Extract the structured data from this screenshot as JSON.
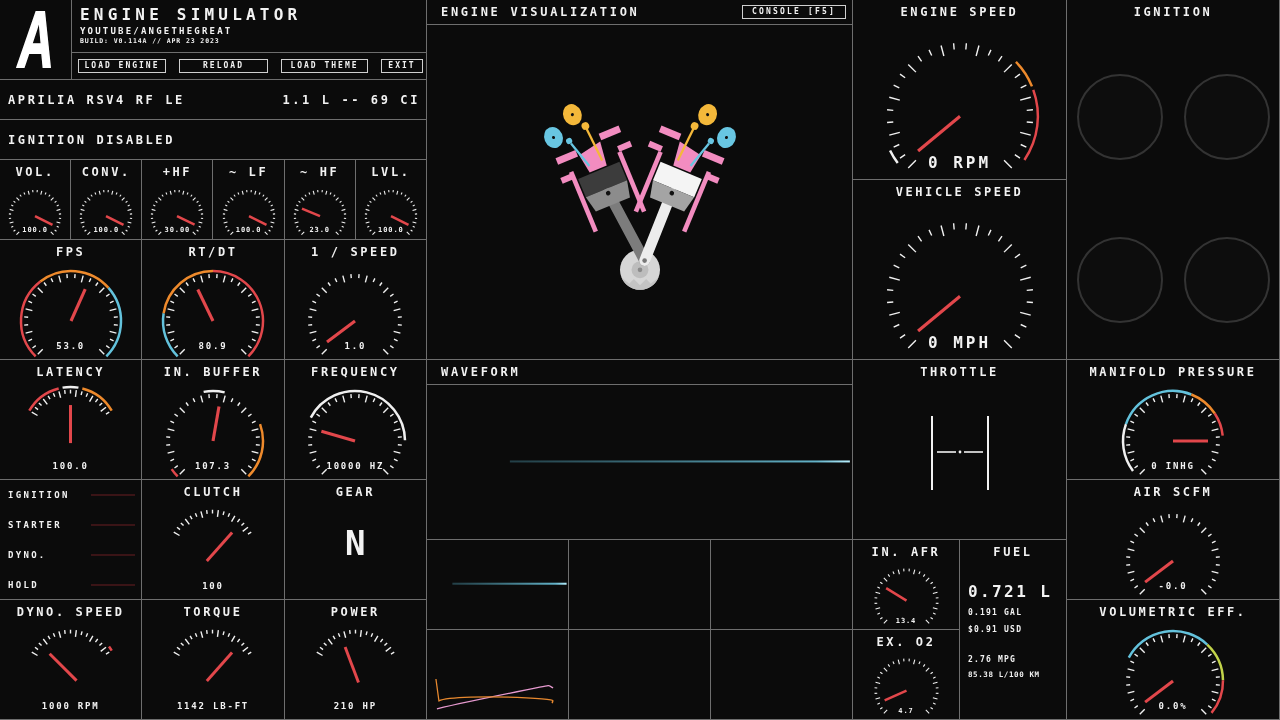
{
  "header": {
    "logo": "A",
    "title": "ENGINE SIMULATOR",
    "channel": "YOUTUBE/ANGETHEGREAT",
    "build": "BUILD: V0.114A // APR 23 2023",
    "buttons": [
      "LOAD ENGINE",
      "RELOAD",
      "LOAD THEME",
      "EXIT"
    ]
  },
  "engine": {
    "name": "APRILIA RSV4 RF LE",
    "displacement": "1.1 L -- 69 CI"
  },
  "status": "IGNITION DISABLED",
  "audio_gauges": [
    {
      "title": "VOL.",
      "kind": "wide",
      "reading": "100.0"
    },
    {
      "title": "CONV.",
      "kind": "wide",
      "reading": "100.0"
    },
    {
      "title": "+HF",
      "kind": "wide",
      "reading": "30.00"
    },
    {
      "title": "~ LF",
      "kind": "wide",
      "reading": "100.0"
    },
    {
      "title": "~ HF",
      "kind": "wide",
      "reading": "23.0"
    },
    {
      "title": "LVL.",
      "kind": "wide",
      "reading": "100.0"
    }
  ],
  "performance_gauges": [
    {
      "title": "FPS",
      "kind": "wide",
      "reading": "53.0"
    },
    {
      "title": "RT/DT",
      "kind": "wide",
      "reading": "80.9"
    },
    {
      "title": "1 / SPEED",
      "kind": "wide",
      "reading": "1.0"
    },
    {
      "title": "LATENCY",
      "kind": "narrow",
      "reading": "100.0"
    },
    {
      "title": "IN. BUFFER",
      "kind": "wide",
      "reading": "107.3"
    },
    {
      "title": "FREQUENCY",
      "kind": "wide",
      "reading": "10000 HZ"
    }
  ],
  "switches": [
    {
      "label": "IGNITION",
      "on": false
    },
    {
      "label": "STARTER",
      "on": false
    },
    {
      "label": "DYNO.",
      "on": false
    },
    {
      "label": "HOLD",
      "on": false
    }
  ],
  "clutch": {
    "title": "CLUTCH",
    "kind": "narrow",
    "reading": "100"
  },
  "gear": {
    "title": "GEAR",
    "value": "N"
  },
  "output_gauges": [
    {
      "title": "DYNO. SPEED",
      "kind": "narrow",
      "reading": "1000 RPM"
    },
    {
      "title": "TORQUE",
      "kind": "narrow",
      "reading": "1142 LB-FT"
    },
    {
      "title": "POWER",
      "kind": "narrow",
      "reading": "210 HP"
    }
  ],
  "engine_visualization": {
    "title": "ENGINE VISUALIZATION",
    "console_button": "CONSOLE [F5]"
  },
  "waveform": {
    "title": "WAVEFORM"
  },
  "speed_gauges": [
    {
      "title": "ENGINE SPEED",
      "kind": "wide",
      "reading": "0 RPM"
    },
    {
      "title": "VEHICLE SPEED",
      "kind": "wide",
      "reading": "0 MPH"
    }
  ],
  "ignition": {
    "title": "IGNITION",
    "cylinders": [
      {
        "lit": false
      },
      {
        "lit": false
      },
      {
        "lit": false
      },
      {
        "lit": false
      }
    ]
  },
  "throttle": {
    "title": "THROTTLE"
  },
  "mixture_gauges": [
    {
      "title": "IN. AFR",
      "kind": "wide",
      "reading": "13.4"
    },
    {
      "title": "EX. O2",
      "kind": "wide",
      "reading": "4.7"
    }
  ],
  "fuel": {
    "title": "FUEL",
    "volume": "0.721 L",
    "gallons": "0.191 GAL",
    "cost": "$0.91 USD",
    "mpg": "2.76 MPG",
    "consumption": "85.38 L/100 KM"
  },
  "air_gauges": [
    {
      "title": "MANIFOLD PRESSURE",
      "kind": "wide",
      "reading": "0 INHG"
    },
    {
      "title": "AIR SCFM",
      "kind": "wide",
      "reading": "-0.0"
    },
    {
      "title": "VOLUMETRIC EFF.",
      "kind": "wide",
      "reading": "0.0%"
    }
  ]
}
